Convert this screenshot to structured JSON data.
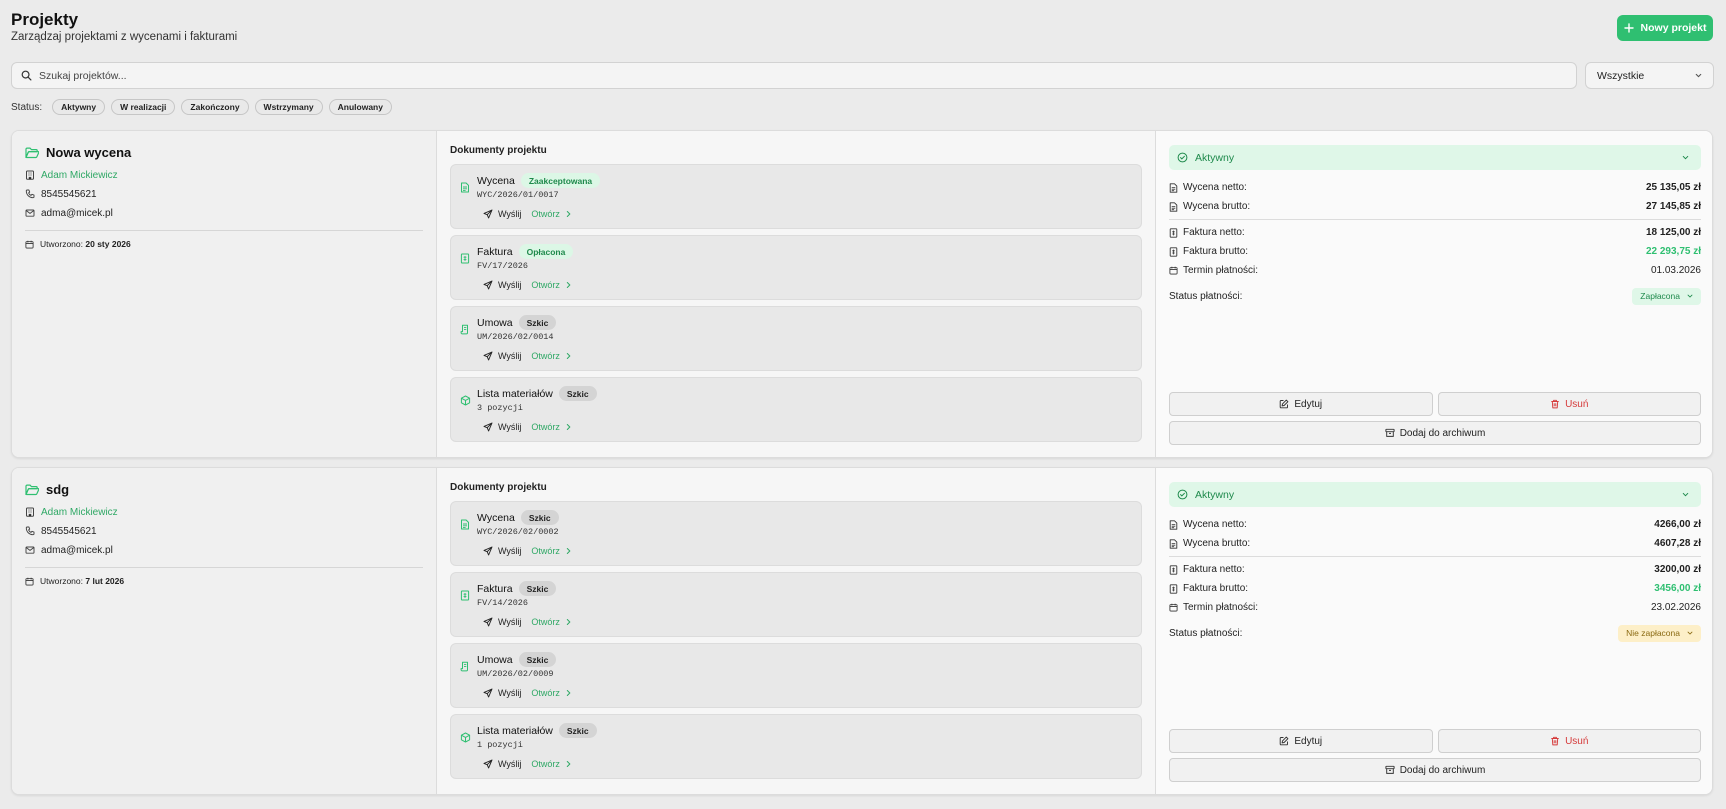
{
  "header": {
    "title": "Projekty",
    "subtitle": "Zarządzaj projektami z wycenami i fakturami",
    "new_button": "Nowy projekt"
  },
  "search": {
    "placeholder": "Szukaj projektów...",
    "value": ""
  },
  "filter": {
    "selected": "Wszystkie"
  },
  "status_filter": {
    "label": "Status:",
    "options": [
      "Aktywny",
      "W realizacji",
      "Zakończony",
      "Wstrzymany",
      "Anulowany"
    ]
  },
  "labels": {
    "docs_title": "Dokumenty projektu",
    "created_prefix": "Utworzono:",
    "send": "Wyślij",
    "open": "Otwórz",
    "quote_net": "Wycena netto:",
    "quote_gross": "Wycena brutto:",
    "invoice_net": "Faktura netto:",
    "invoice_gross": "Faktura brutto:",
    "due_date": "Termin płatności:",
    "payment_status": "Status płatności:",
    "edit": "Edytuj",
    "delete": "Usuń",
    "archive": "Dodaj do archiwum"
  },
  "projects": [
    {
      "name": "Nowa wycena",
      "client": "Adam Mickiewicz",
      "phone": "8545545621",
      "email": "adma@micek.pl",
      "created": "20 sty 2026",
      "documents": [
        {
          "name": "Wycena",
          "badge": "Zaakceptowana",
          "number": "WYC/2026/01/0017"
        },
        {
          "name": "Faktura",
          "badge": "Opłacona",
          "number": "FV/17/2026"
        },
        {
          "name": "Umowa",
          "badge": "Szkic",
          "number": "UM/2026/02/0014"
        },
        {
          "name": "Lista materiałów",
          "badge": "Szkic",
          "number": "3 pozycji"
        }
      ],
      "status": "Aktywny",
      "quote_net": "25 135,05 zł",
      "quote_gross": "27 145,85 zł",
      "invoice_net": "18 125,00 zł",
      "invoice_gross": "22 293,75 zł",
      "due_date": "01.03.2026",
      "payment_status": "Zapłacona"
    },
    {
      "name": "sdg",
      "client": "Adam Mickiewicz",
      "phone": "8545545621",
      "email": "adma@micek.pl",
      "created": "7 lut 2026",
      "documents": [
        {
          "name": "Wycena",
          "badge": "Szkic",
          "number": "WYC/2026/02/0002"
        },
        {
          "name": "Faktura",
          "badge": "Szkic",
          "number": "FV/14/2026"
        },
        {
          "name": "Umowa",
          "badge": "Szkic",
          "number": "UM/2026/02/0009"
        },
        {
          "name": "Lista materiałów",
          "badge": "Szkic",
          "number": "1 pozycji"
        }
      ],
      "status": "Aktywny",
      "quote_net": "4266,00 zł",
      "quote_gross": "4607,28 zł",
      "invoice_net": "3200,00 zł",
      "invoice_gross": "3456,00 zł",
      "due_date": "23.02.2026",
      "payment_status": "Nie zapłacona"
    }
  ],
  "colors": {
    "accent": "#2fbf71",
    "accent_text": "#2fa865",
    "danger": "#d63a3a",
    "unpaid_bg": "#fdefc8"
  }
}
